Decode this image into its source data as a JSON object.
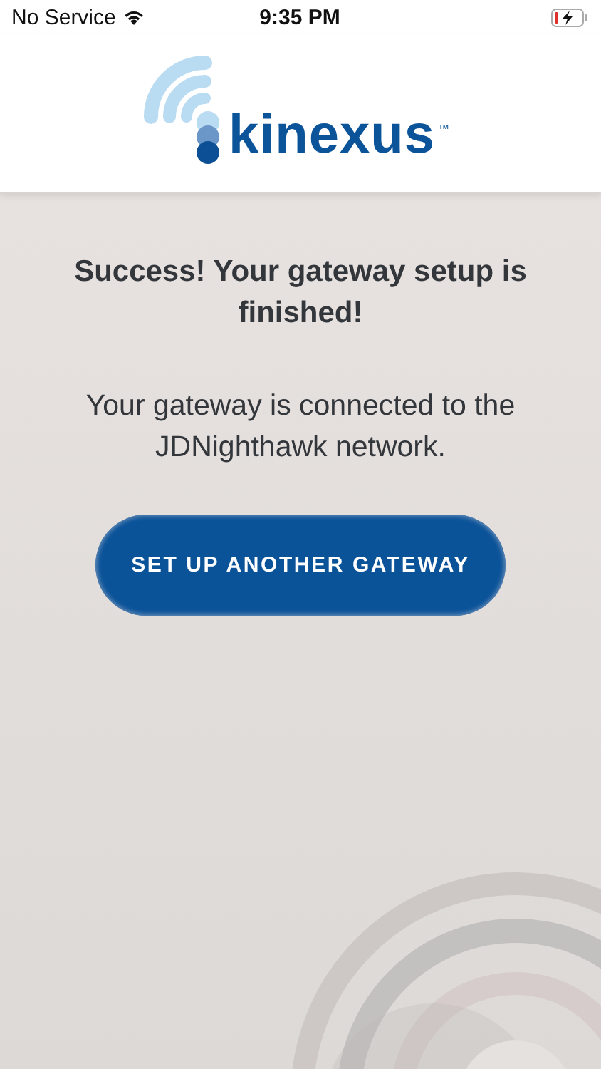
{
  "status_bar": {
    "carrier": "No Service",
    "time": "9:35 PM"
  },
  "header": {
    "logo_text": "kinexus",
    "trademark": "™"
  },
  "content": {
    "title": "Success! Your gateway setup is finished!",
    "message": "Your gateway is connected to the JDNighthawk network.",
    "button": "SET UP ANOTHER GATEWAY"
  }
}
